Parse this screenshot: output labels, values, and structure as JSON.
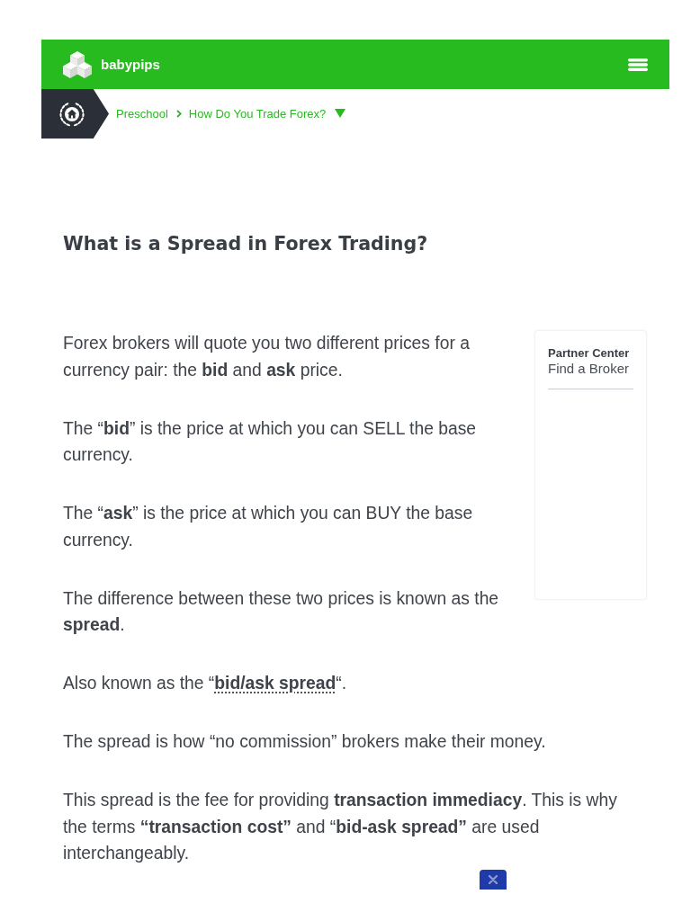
{
  "header": {
    "logo_text": "babypips"
  },
  "breadcrumb": {
    "items": [
      {
        "label": "Preschool"
      },
      {
        "label": "How Do You Trade Forex?"
      }
    ]
  },
  "article": {
    "title": "What is a Spread in Forex Trading?",
    "paragraphs": [
      {
        "kind": "text",
        "text": "Forex brokers will quote you two different prices for a currency pair: the **bid** and **ask** price."
      },
      {
        "kind": "text",
        "text": "The “**bid**” is the price at which you can SELL the base currency."
      },
      {
        "kind": "text",
        "text": "The “**ask**” is the price at which you can BUY the base currency."
      },
      {
        "kind": "text",
        "text": "The difference between these two prices is known as the **spread**."
      },
      {
        "kind": "link",
        "before": "Also known as the “",
        "link": "bid/ask spread",
        "after": "“."
      },
      {
        "kind": "text",
        "text": "The spread is how “no commission” brokers make their money."
      },
      {
        "kind": "text",
        "text": "This spread is the fee for providing **transaction immediacy**. This is why the terms **“transaction cost”** and “**bid-ask spread”** are used interchangeably."
      }
    ]
  },
  "sidebar": {
    "heading": "Partner Center",
    "link": "Find a Broker"
  }
}
